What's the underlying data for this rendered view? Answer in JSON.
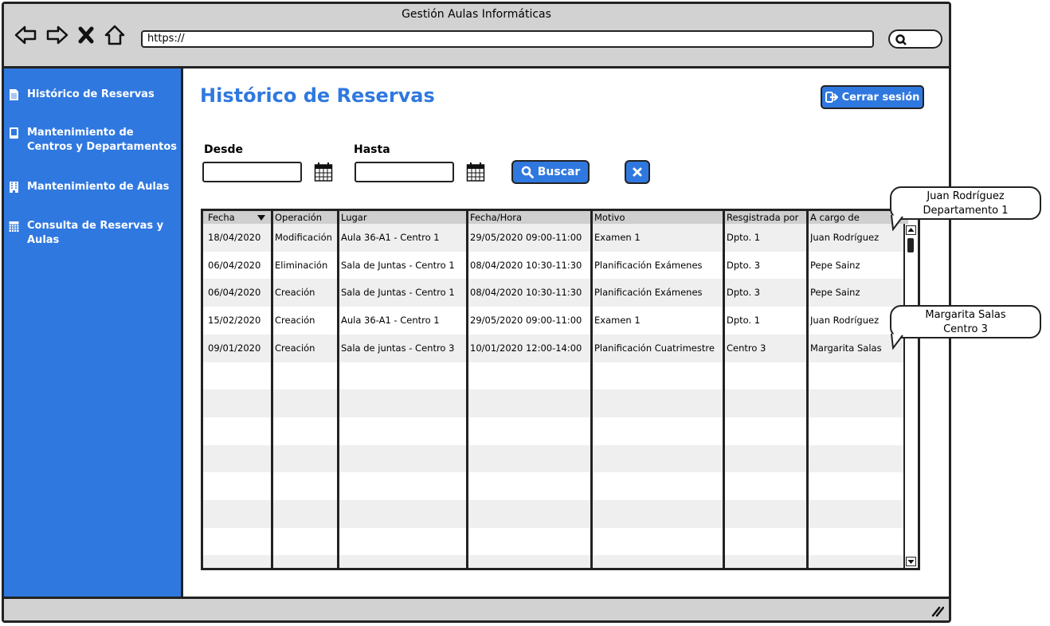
{
  "window": {
    "title": "Gestión Aulas Informáticas",
    "url": "https://"
  },
  "sidebar": {
    "items": [
      {
        "label": "Histórico de Reservas"
      },
      {
        "label": "Mantenimiento de Centros y Departamentos"
      },
      {
        "label": "Mantenimiento de Aulas"
      },
      {
        "label": "Consulta de Reservas y Aulas"
      }
    ]
  },
  "page": {
    "title": "Histórico de Reservas",
    "logout_label": "Cerrar sesión"
  },
  "filters": {
    "from_label": "Desde",
    "to_label": "Hasta",
    "search_label": "Buscar"
  },
  "table": {
    "headers": [
      "Fecha",
      "Operación",
      "Lugar",
      "Fecha/Hora",
      "Motivo",
      "Resgistrada por",
      "A cargo de"
    ],
    "rows": [
      [
        "18/04/2020",
        "Modificación",
        "Aula 36-A1 - Centro 1",
        "29/05/2020 09:00-11:00",
        "Examen 1",
        "Dpto. 1",
        "Juan Rodríguez"
      ],
      [
        "06/04/2020",
        "Eliminación",
        "Sala de Juntas - Centro 1",
        "08/04/2020 10:30-11:30",
        "Planificación Exámenes",
        "Dpto. 3",
        "Pepe Sainz"
      ],
      [
        "06/04/2020",
        "Creación",
        "Sala de Juntas - Centro 1",
        "08/04/2020 10:30-11:30",
        "Planificación Exámenes",
        "Dpto. 3",
        "Pepe Sainz"
      ],
      [
        "15/02/2020",
        "Creación",
        "Aula 36-A1 - Centro 1",
        "29/05/2020 09:00-11:00",
        "Examen 1",
        "Dpto. 1",
        "Juan Rodríguez"
      ],
      [
        "09/01/2020",
        "Creación",
        "Sala de juntas - Centro 3",
        "10/01/2020 12:00-14:00",
        "Planificación Cuatrimestre",
        "Centro 3",
        "Margarita Salas"
      ]
    ]
  },
  "callouts": [
    {
      "line1": "Juan Rodríguez",
      "line2": "Departamento 1"
    },
    {
      "line1": "Margarita Salas",
      "line2": "Centro 3"
    }
  ],
  "colors": {
    "accent": "#2f78e0",
    "chrome": "#d2d2d2",
    "stripe": "#efefef"
  }
}
